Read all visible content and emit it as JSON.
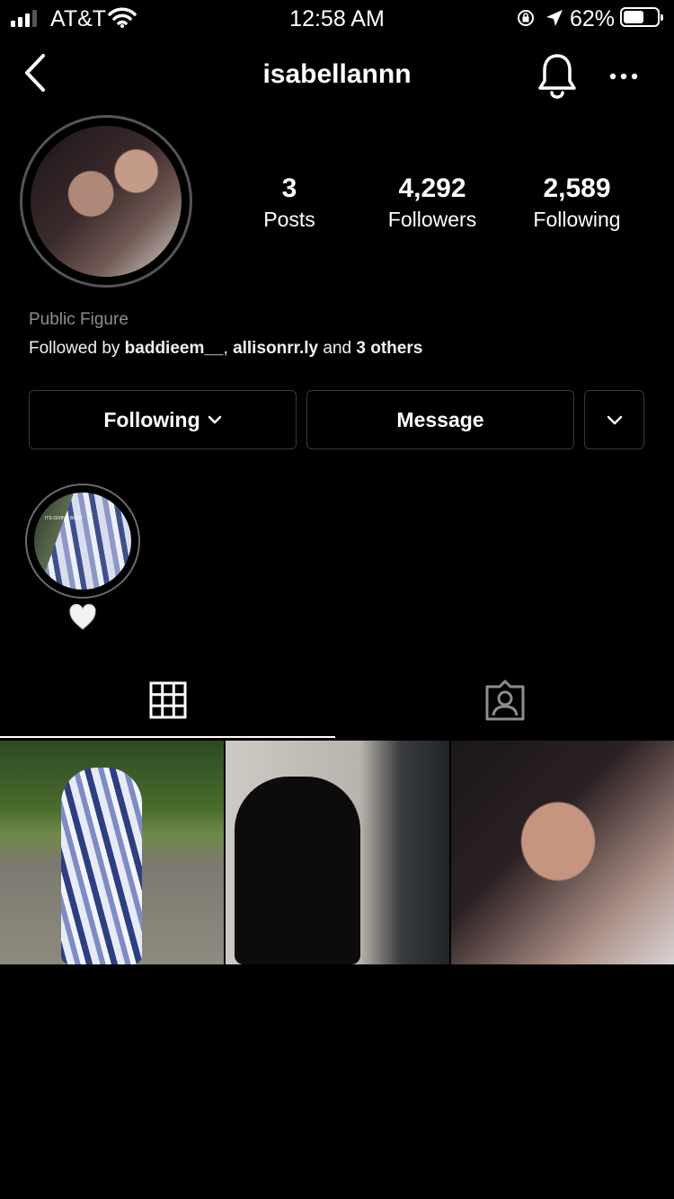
{
  "status_bar": {
    "carrier": "AT&T",
    "time": "12:58 AM",
    "battery_percent": "62%",
    "battery_level": 0.62,
    "signal_bars": 3
  },
  "header": {
    "username": "isabellannn",
    "back_icon": "chevron-left-icon",
    "bell_icon": "bell-icon",
    "more_icon": "more-horizontal-icon"
  },
  "profile": {
    "stats": [
      {
        "value": "3",
        "label": "Posts"
      },
      {
        "value": "4,292",
        "label": "Followers"
      },
      {
        "value": "2,589",
        "label": "Following"
      }
    ],
    "category": "Public Figure",
    "followed_by": {
      "prefix": "Followed by ",
      "user1": "baddieem__",
      "sep": ", ",
      "user2": "allisonrr.ly",
      "and": " and ",
      "others": "3 others"
    }
  },
  "actions": {
    "following_label": "Following",
    "message_label": "Message"
  },
  "highlights": [
    {
      "label_icon": "white-heart-emoji",
      "caption": "ITS GIVING BODY"
    }
  ],
  "tabs": [
    {
      "name": "grid",
      "icon": "grid-icon",
      "active": true
    },
    {
      "name": "tagged",
      "icon": "tagged-person-icon",
      "active": false
    }
  ],
  "posts": [
    {
      "description": "photo-1"
    },
    {
      "description": "photo-2"
    },
    {
      "description": "photo-3"
    }
  ],
  "colors": {
    "background": "#000000",
    "text": "#ffffff",
    "secondary_text": "#8e8e8e",
    "border": "#3a3a3a"
  }
}
